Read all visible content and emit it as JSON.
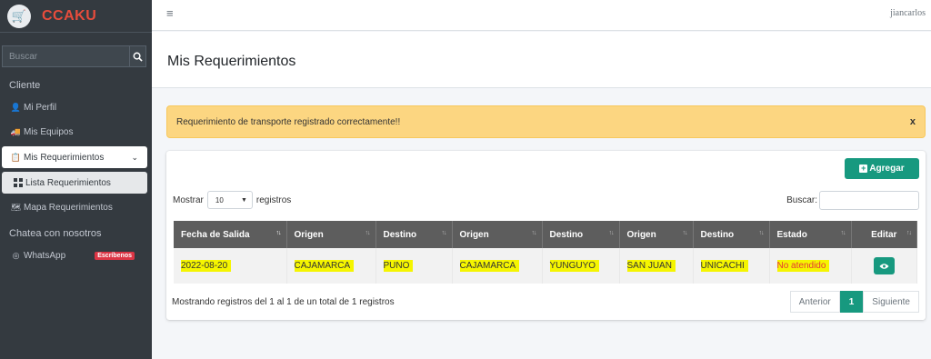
{
  "brand": {
    "name": "CCAKU"
  },
  "user": {
    "name": "jiancarlos"
  },
  "sidebar": {
    "search_placeholder": "Buscar",
    "section_cliente": "Cliente",
    "mi_perfil": "Mi Perfil",
    "mis_equipos": "Mis Equipos",
    "mis_requerimientos": "Mis Requerimientos",
    "lista_requerimientos": "Lista Requerimientos",
    "mapa_requerimientos": "Mapa Requerimientos",
    "section_chat": "Chatea con nosotros",
    "whatsapp": "WhatsApp",
    "whatsapp_badge": "Escríbenos"
  },
  "page": {
    "title": "Mis Requerimientos"
  },
  "alert": {
    "text": "Requerimiento de transporte registrado correctamente!!",
    "close": "x"
  },
  "toolbar": {
    "add_label": "Agregar"
  },
  "datatable": {
    "length_prefix": "Mostrar",
    "length_value": "10",
    "length_suffix": "registros",
    "search_label": "Buscar:",
    "columns": [
      "Fecha de Salida",
      "Origen",
      "Destino",
      "Origen",
      "Destino",
      "Origen",
      "Destino",
      "Estado",
      "Editar"
    ],
    "rows": [
      [
        "2022-08-20",
        "CAJAMARCA",
        "PUNO",
        "CAJAMARCA",
        "YUNGUYO",
        "SAN JUAN",
        "UNICACHI",
        "No atendido"
      ]
    ],
    "info": "Mostrando registros del 1 al 1 de un total de 1 registros",
    "prev": "Anterior",
    "page": "1",
    "next": "Siguiente"
  },
  "colors": {
    "accent": "#17997f",
    "sidebar": "#343a40",
    "alert": "#fcd681",
    "highlight": "#f5f500",
    "danger": "#e53935"
  }
}
